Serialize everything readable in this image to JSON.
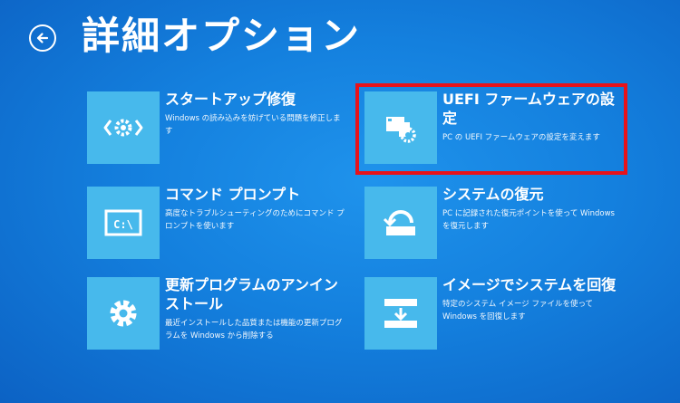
{
  "header": {
    "title": "詳細オプション",
    "back_icon": "back-arrow-icon"
  },
  "options": [
    {
      "title": "スタートアップ修復",
      "description": "Windows の読み込みを妨げている問題を修正します",
      "icon": "startup-repair-icon"
    },
    {
      "title": "UEFI ファームウェアの設定",
      "description": "PC の UEFI ファームウェアの設定を変えます",
      "icon": "firmware-settings-icon"
    },
    {
      "title": "コマンド プロンプト",
      "description": "高度なトラブルシューティングのためにコマンド プロンプトを使います",
      "icon": "command-prompt-icon"
    },
    {
      "title": "システムの復元",
      "description": "PC に記録された復元ポイントを使って Windows を復元します",
      "icon": "system-restore-icon"
    },
    {
      "title": "更新プログラムのアンインストール",
      "description": "最近インストールした品質または機能の更新プログラムを Windows から削除する",
      "icon": "uninstall-updates-gear-icon"
    },
    {
      "title": "イメージでシステムを回復",
      "description": "特定のシステム イメージ ファイルを使って Windows を回復します",
      "icon": "system-image-recovery-icon"
    }
  ],
  "colors": {
    "background": "#1480de",
    "tile": "#47b9ec",
    "highlight": "#e8121a",
    "text": "#ffffff"
  }
}
